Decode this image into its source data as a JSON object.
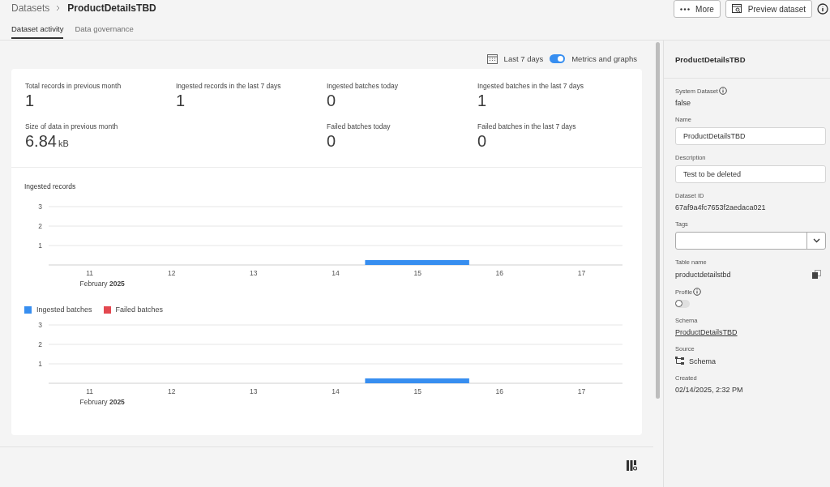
{
  "breadcrumb": {
    "parent": "Datasets",
    "current": "ProductDetailsTBD"
  },
  "actions": [
    {
      "label": "More"
    },
    {
      "label": "Preview dataset"
    }
  ],
  "tabs": [
    {
      "label": "Dataset activity",
      "selected": true
    },
    {
      "label": "Data governance",
      "selected": false
    }
  ],
  "toolbar": {
    "range": "Last 7 days",
    "toggle_label": "Metrics and graphs",
    "toggle_on": true
  },
  "metrics": [
    {
      "label": "Total records in previous month",
      "value": "1"
    },
    {
      "label": "Ingested records in the last 7 days",
      "value": "1"
    },
    {
      "label": "Ingested batches today",
      "value": "0"
    },
    {
      "label": "Ingested batches in the last 7 days",
      "value": "1"
    },
    {
      "label": "Size of data in previous month",
      "value": "6.84",
      "unit": "kB"
    },
    {
      "label": "Failed batches today",
      "value": "0"
    },
    {
      "label": "Failed batches in the last 7 days",
      "value": "0"
    }
  ],
  "charts": [
    {
      "title": "Ingested records",
      "date_caption": "February **2025**",
      "chart_data": {
        "type": "bar",
        "categories": [
          "11",
          "12",
          "13",
          "14",
          "15",
          "16",
          "17"
        ],
        "yticks": [
          1,
          2,
          3
        ],
        "ylim": [
          0,
          3
        ],
        "series": [
          {
            "color": "#378ef0",
            "values": [
              0,
              0,
              0,
              0,
              0.25,
              0,
              0
            ]
          }
        ]
      }
    },
    {
      "date_caption": "February **2025**",
      "chart_data": {
        "type": "bar",
        "categories": [
          "11",
          "12",
          "13",
          "14",
          "15",
          "16",
          "17"
        ],
        "yticks": [
          1,
          2,
          3
        ],
        "ylim": [
          0,
          3
        ],
        "series": [
          {
            "name": "Ingested batches",
            "color": "#378ef0",
            "values": [
              0,
              0,
              0,
              0,
              0.25,
              0,
              0
            ]
          },
          {
            "name": "Failed batches",
            "color": "#e34850",
            "values": [
              0,
              0,
              0,
              0,
              0,
              0,
              0
            ]
          }
        ]
      }
    }
  ],
  "panel": {
    "title": "ProductDetailsTBD",
    "fields": [
      {
        "kind": "text",
        "label": "System Dataset",
        "info": true,
        "value": "false"
      },
      {
        "kind": "input",
        "label": "Name",
        "value": "ProductDetailsTBD"
      },
      {
        "kind": "input",
        "label": "Description",
        "value": "Test to be deleted"
      },
      {
        "kind": "text",
        "label": "Dataset ID",
        "value": "67af9a4fc7653f2aedaca021"
      },
      {
        "kind": "combo",
        "label": "Tags"
      },
      {
        "kind": "copy",
        "label": "Table name",
        "value": "productdetailstbd"
      },
      {
        "kind": "toggle",
        "label": "Profile",
        "info": true,
        "on": false
      },
      {
        "kind": "link",
        "label": "Schema",
        "value": "ProductDetailsTBD"
      },
      {
        "kind": "source",
        "label": "Source",
        "value": "Schema"
      },
      {
        "kind": "text",
        "label": "Created",
        "value": "02/14/2025, 2:32 PM"
      }
    ]
  }
}
